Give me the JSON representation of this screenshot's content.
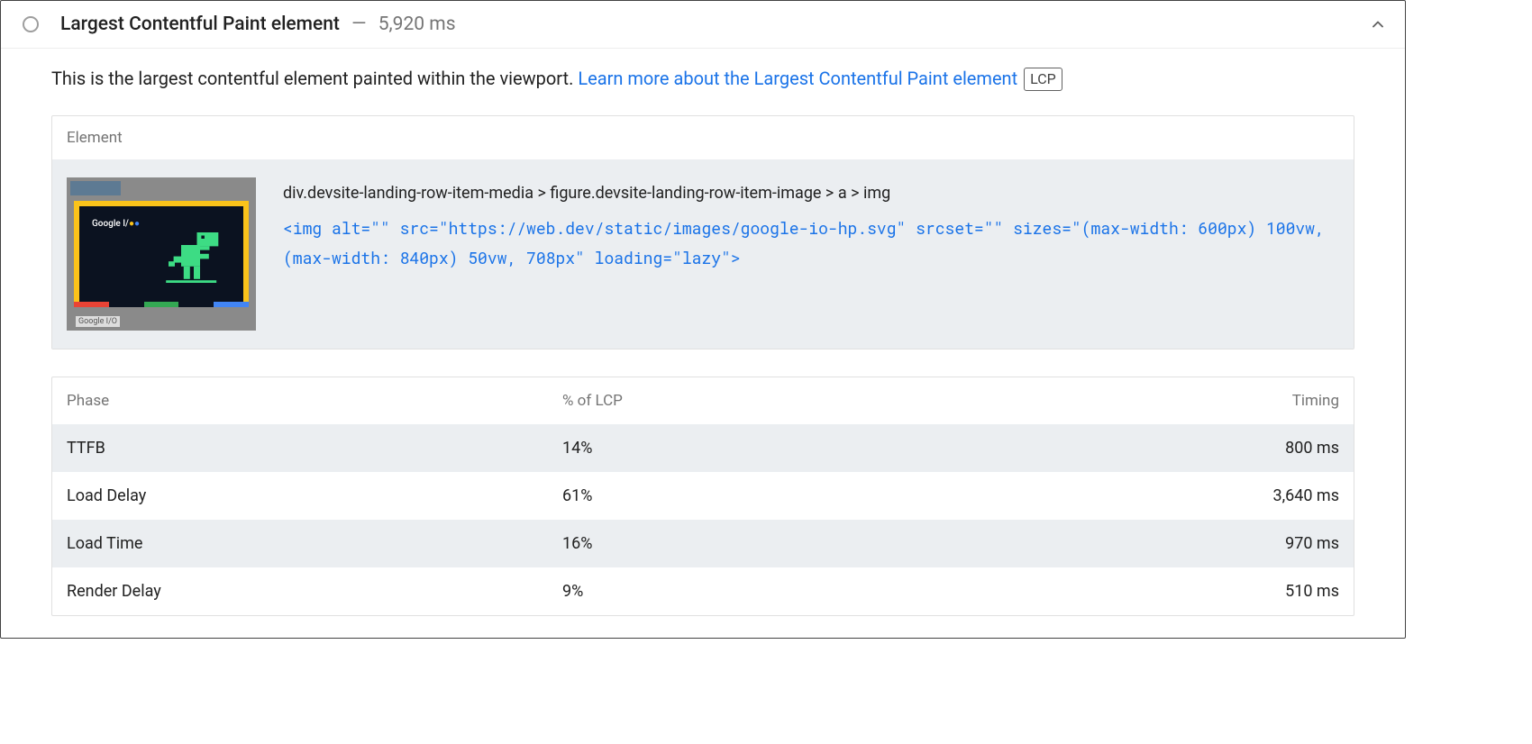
{
  "audit": {
    "title": "Largest Contentful Paint element",
    "separator": "—",
    "timing": "5,920 ms"
  },
  "description": {
    "text": "This is the largest contentful element painted within the viewport. ",
    "link_text": "Learn more about the Largest Contentful Paint element",
    "badge": "LCP"
  },
  "element_section": {
    "header": "Element",
    "selector_path": "div.devsite-landing-row-item-media > figure.devsite-landing-row-item-image > a > img",
    "html_snippet": "<img alt=\"\" src=\"https://web.dev/static/images/google-io-hp.svg\" srcset=\"\" sizes=\"(max-width: 600px) 100vw, (max-width: 840px) 50vw, 708px\" loading=\"lazy\">",
    "thumb_label": "Google I/O",
    "thumb_footer": "Google I/O"
  },
  "phase_table": {
    "headers": {
      "phase": "Phase",
      "pct": "% of LCP",
      "timing": "Timing"
    },
    "rows": [
      {
        "phase": "TTFB",
        "pct": "14%",
        "timing": "800 ms"
      },
      {
        "phase": "Load Delay",
        "pct": "61%",
        "timing": "3,640 ms"
      },
      {
        "phase": "Load Time",
        "pct": "16%",
        "timing": "970 ms"
      },
      {
        "phase": "Render Delay",
        "pct": "9%",
        "timing": "510 ms"
      }
    ]
  }
}
